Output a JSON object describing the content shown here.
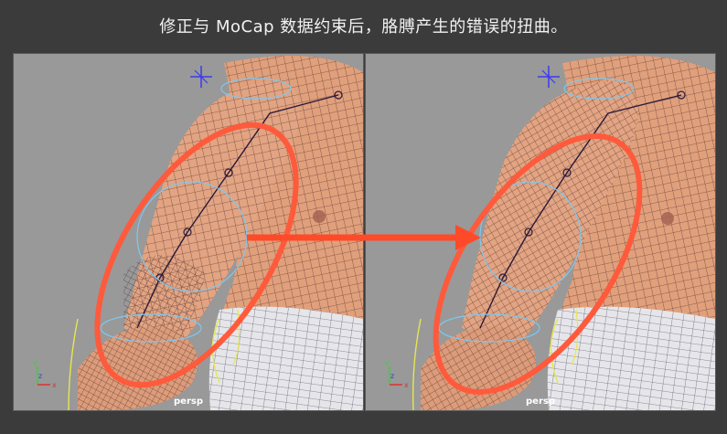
{
  "caption": "修正与 MoCap 数据约束后，胳膊产生的错误的扭曲。",
  "viewports": {
    "left": {
      "camera_label": "persp",
      "axis": {
        "x": "x",
        "y": "y",
        "z": "z"
      }
    },
    "right": {
      "camera_label": "persp",
      "axis": {
        "x": "x",
        "y": "y",
        "z": "z"
      }
    }
  },
  "colors": {
    "background": "#3b3b3b",
    "viewport": "#999999",
    "skin": "#e0a07c",
    "wire": "#4a2a2a",
    "highlight_ellipse": "#ff5a3c",
    "controller": "#7ec8f0",
    "locator": "#3a3af0",
    "arrow": "#ff4a2a"
  },
  "icons": [
    "locator-cross-icon",
    "axis-gizmo-icon"
  ]
}
